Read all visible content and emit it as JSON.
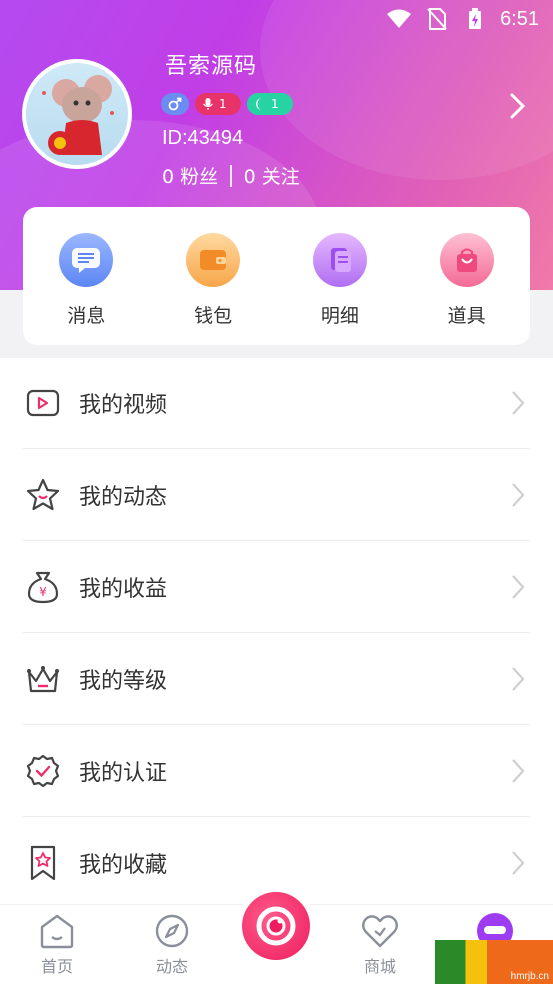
{
  "status_bar": {
    "time": "6:51"
  },
  "profile": {
    "name": "吾索源码",
    "id_text": "ID:43494",
    "fans_text": "0 粉丝",
    "following_text": "0 关注",
    "badges": {
      "mic_level": "1",
      "moon_level": "1"
    }
  },
  "quick_actions": [
    {
      "label": "消息",
      "icon": "message-icon"
    },
    {
      "label": "钱包",
      "icon": "wallet-icon"
    },
    {
      "label": "明细",
      "icon": "detail-icon"
    },
    {
      "label": "道具",
      "icon": "props-bag-icon"
    }
  ],
  "menu": [
    {
      "label": "我的视频",
      "icon": "video-play-icon"
    },
    {
      "label": "我的动态",
      "icon": "star-icon"
    },
    {
      "label": "我的收益",
      "icon": "money-bag-icon"
    },
    {
      "label": "我的等级",
      "icon": "crown-icon"
    },
    {
      "label": "我的认证",
      "icon": "verified-badge-icon"
    },
    {
      "label": "我的收藏",
      "icon": "bookmark-star-icon"
    }
  ],
  "tabbar": [
    {
      "label": "首页",
      "icon": "home-icon"
    },
    {
      "label": "动态",
      "icon": "compass-icon"
    },
    {
      "label": "商城",
      "icon": "heart-icon"
    }
  ],
  "watermark": {
    "text": "hmrjb.cn"
  },
  "colors": {
    "accent": "#e8336a",
    "header_start": "#b44bf0",
    "header_end": "#f07aa8",
    "tab_inactive": "#8a8f9a"
  }
}
